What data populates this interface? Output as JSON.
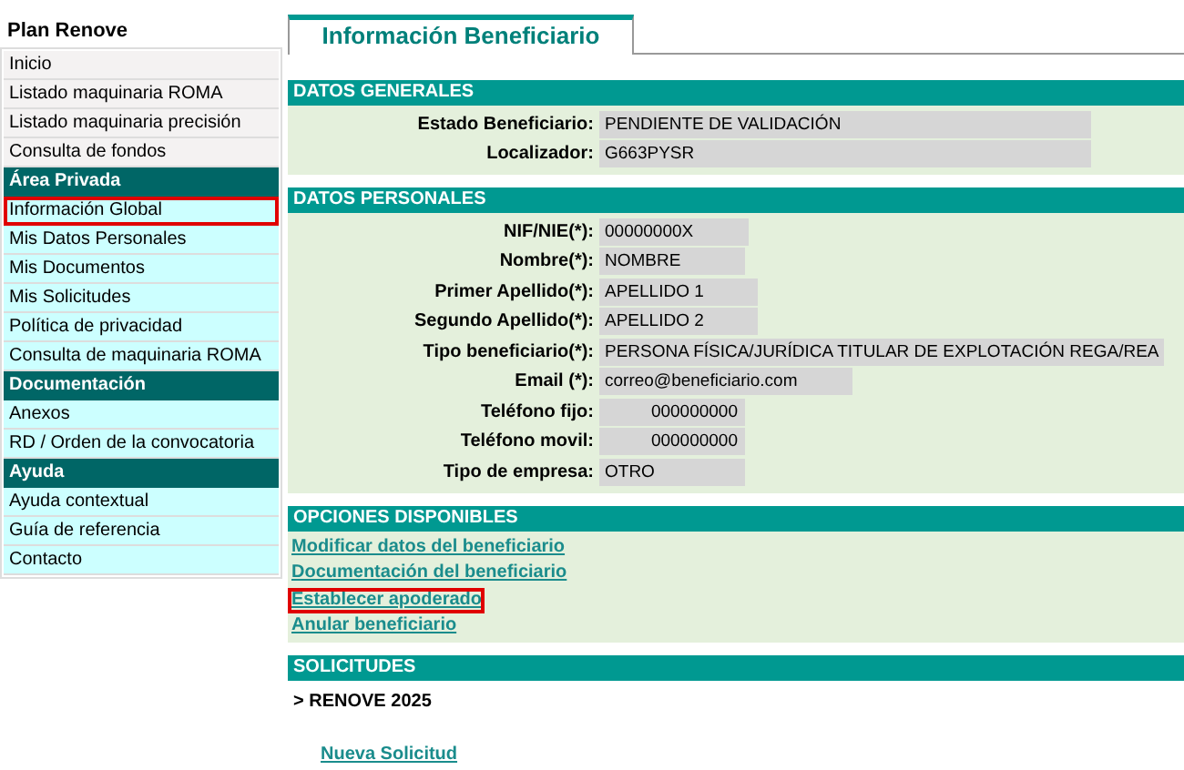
{
  "sidebar": {
    "title": "Plan Renove",
    "groups": [
      {
        "items": [
          {
            "label": "Inicio",
            "highlighted": false
          },
          {
            "label": "Listado maquinaria ROMA",
            "highlighted": false
          },
          {
            "label": "Listado maquinaria precisión",
            "highlighted": false
          },
          {
            "label": "Consulta de fondos",
            "highlighted": false
          }
        ]
      },
      {
        "heading": "Área Privada",
        "items": [
          {
            "label": "Información Global",
            "highlighted": true
          },
          {
            "label": "Mis Datos Personales",
            "highlighted": false
          },
          {
            "label": "Mis Documentos",
            "highlighted": false
          },
          {
            "label": "Mis Solicitudes",
            "highlighted": false
          },
          {
            "label": "Política de privacidad",
            "highlighted": false
          },
          {
            "label": "Consulta de maquinaria ROMA",
            "highlighted": false
          }
        ]
      },
      {
        "heading": "Documentación",
        "items": [
          {
            "label": "Anexos",
            "highlighted": false
          },
          {
            "label": "RD / Orden de la convocatoria",
            "highlighted": false
          }
        ]
      },
      {
        "heading": "Ayuda",
        "items": [
          {
            "label": "Ayuda contextual",
            "highlighted": false
          },
          {
            "label": "Guía de referencia",
            "highlighted": false
          },
          {
            "label": "Contacto",
            "highlighted": false
          }
        ]
      }
    ]
  },
  "tab": {
    "label": "Información Beneficiario",
    "selected": true
  },
  "sections": [
    {
      "kind": "fields",
      "title": "DATOS GENERALES",
      "fields": [
        {
          "label": "Estado Beneficiario:",
          "value": "PENDIENTE DE VALIDACIÓN",
          "kind": "text"
        },
        {
          "label": "Localizador:",
          "value": "G663PYSR",
          "kind": "text"
        }
      ]
    },
    {
      "kind": "fields",
      "title": "DATOS PERSONALES",
      "fields": [
        {
          "label": "NIF/NIE(*):",
          "value": "00000000X",
          "kind": "text"
        },
        {
          "label": "Nombre(*):",
          "value": "NOMBRE",
          "kind": "text"
        },
        {
          "label": "Primer Apellido(*):",
          "value": "APELLIDO 1",
          "kind": "text"
        },
        {
          "label": "Segundo Apellido(*):",
          "value": "APELLIDO 2",
          "kind": "text"
        },
        {
          "label": "Tipo beneficiario(*):",
          "value": "PERSONA FÍSICA/JURÍDICA TITULAR DE EXPLOTACIÓN REGA/REA",
          "kind": "text"
        },
        {
          "label": "Email (*):",
          "value": "correo@beneficiario.com",
          "kind": "text"
        },
        {
          "label": "Teléfono fijo:",
          "value": "000000000",
          "kind": "number"
        },
        {
          "label": "Teléfono movil:",
          "value": "000000000",
          "kind": "number"
        },
        {
          "label": "Tipo de empresa:",
          "value": "OTRO",
          "kind": "text"
        }
      ]
    },
    {
      "kind": "links",
      "title": "OPCIONES DISPONIBLES",
      "links": [
        {
          "label": "Modificar datos del beneficiario",
          "highlighted": false
        },
        {
          "label": "Documentación del beneficiario",
          "highlighted": false
        },
        {
          "label": "Establecer apoderado",
          "highlighted": true
        },
        {
          "label": "Anular beneficiario",
          "highlighted": false
        }
      ]
    },
    {
      "kind": "requests",
      "title": "SOLICITUDES",
      "group": "> RENOVE 2025",
      "link": "Nueva Solicitud"
    }
  ]
}
